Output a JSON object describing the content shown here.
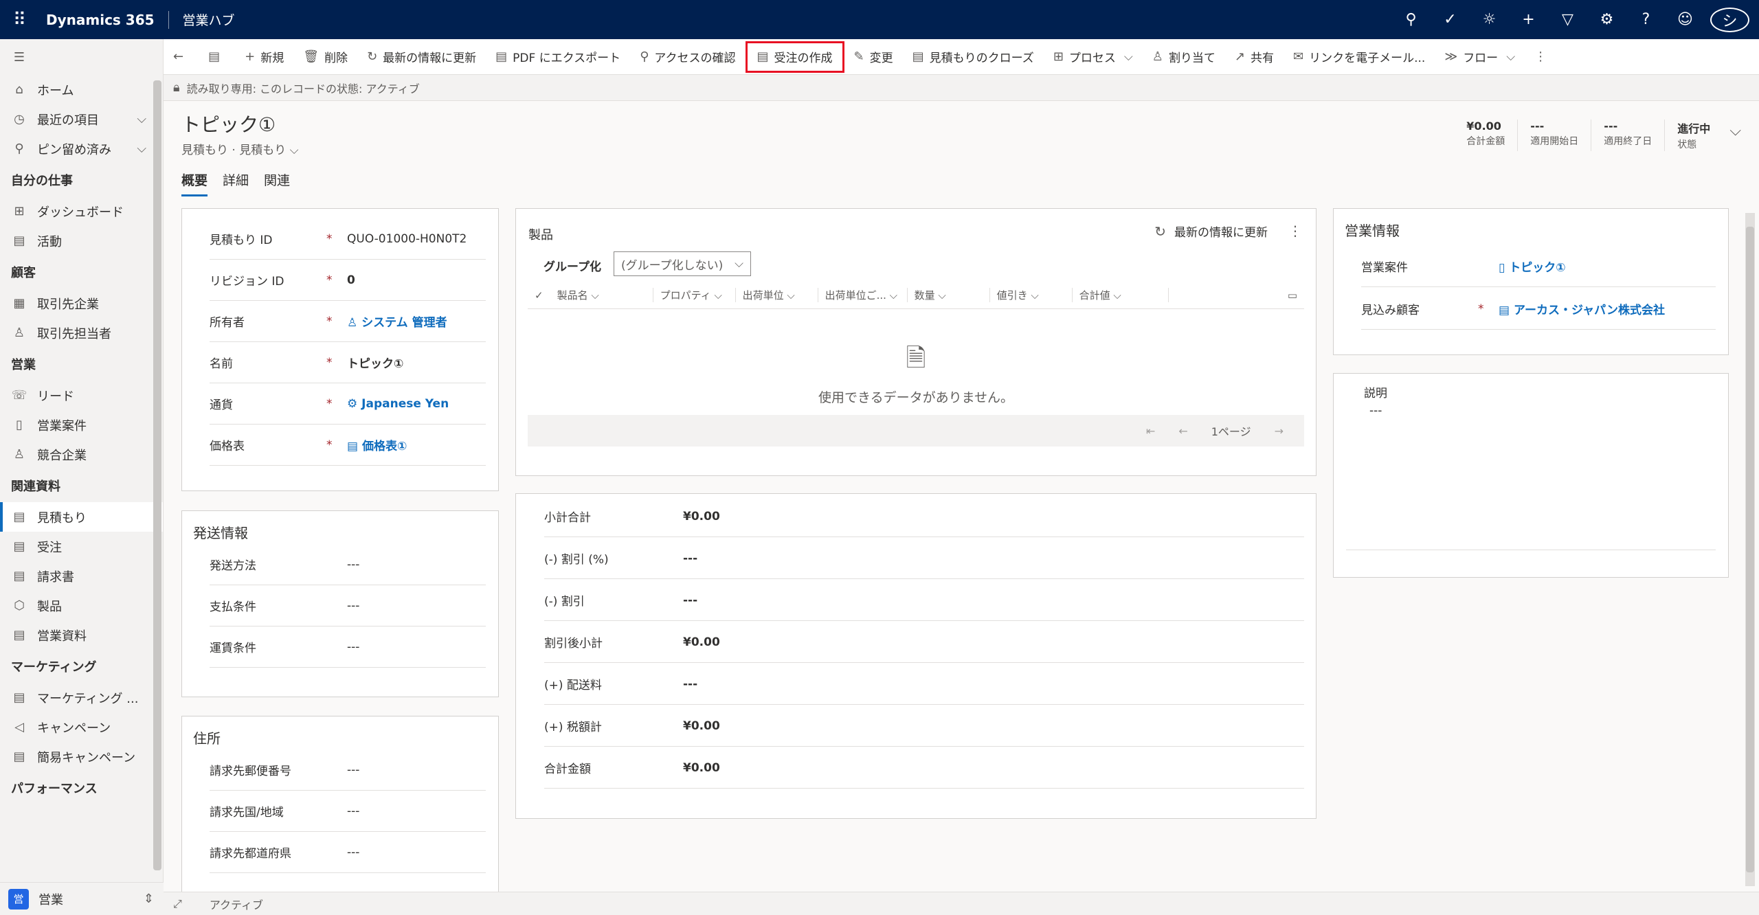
{
  "app": {
    "title": "Dynamics 365",
    "hub": "営業ハブ",
    "avatar": "シ"
  },
  "sidebar": {
    "items": [
      {
        "type": "item",
        "icon": "⌂",
        "label": "ホーム"
      },
      {
        "type": "item",
        "icon": "◷",
        "label": "最近の項目",
        "chev": "⌵"
      },
      {
        "type": "item",
        "icon": "⚲",
        "label": "ピン留め済み",
        "chev": "⌵"
      },
      {
        "type": "group",
        "label": "自分の仕事"
      },
      {
        "type": "item",
        "icon": "⊞",
        "label": "ダッシュボード"
      },
      {
        "type": "item",
        "icon": "▤",
        "label": "活動"
      },
      {
        "type": "group",
        "label": "顧客"
      },
      {
        "type": "item",
        "icon": "▦",
        "label": "取引先企業"
      },
      {
        "type": "item",
        "icon": "♙",
        "label": "取引先担当者"
      },
      {
        "type": "group",
        "label": "営業"
      },
      {
        "type": "item",
        "icon": "☏",
        "label": "リード"
      },
      {
        "type": "item",
        "icon": "▯",
        "label": "営業案件"
      },
      {
        "type": "item",
        "icon": "♙",
        "label": "競合企業"
      },
      {
        "type": "group",
        "label": "関連資料"
      },
      {
        "type": "item",
        "icon": "▤",
        "label": "見積もり",
        "active": true
      },
      {
        "type": "item",
        "icon": "▤",
        "label": "受注"
      },
      {
        "type": "item",
        "icon": "▤",
        "label": "請求書"
      },
      {
        "type": "item",
        "icon": "⬡",
        "label": "製品"
      },
      {
        "type": "item",
        "icon": "▤",
        "label": "営業資料"
      },
      {
        "type": "group",
        "label": "マーケティング"
      },
      {
        "type": "item",
        "icon": "▤",
        "label": "マーケティング ..."
      },
      {
        "type": "item",
        "icon": "◁",
        "label": "キャンペーン"
      },
      {
        "type": "item",
        "icon": "▤",
        "label": "簡易キャンペーン"
      },
      {
        "type": "group",
        "label": "パフォーマンス"
      }
    ],
    "area": {
      "badge": "営",
      "label": "営業"
    }
  },
  "cmdbar": {
    "items": [
      {
        "icon": "←",
        "label": ""
      },
      {
        "icon": "▤",
        "label": ""
      },
      {
        "icon": "+",
        "label": "新規"
      },
      {
        "icon": "🗑",
        "label": "削除"
      },
      {
        "icon": "↻",
        "label": "最新の情報に更新"
      },
      {
        "icon": "▤",
        "label": "PDF にエクスポート"
      },
      {
        "icon": "⚲",
        "label": "アクセスの確認"
      },
      {
        "icon": "▤",
        "label": "受注の作成",
        "highlight": true
      },
      {
        "icon": "✎",
        "label": "変更"
      },
      {
        "icon": "▤",
        "label": "見積もりのクローズ"
      },
      {
        "icon": "⊞",
        "label": "プロセス",
        "chev": "⌵"
      },
      {
        "icon": "♙",
        "label": "割り当て"
      },
      {
        "icon": "↗",
        "label": "共有"
      },
      {
        "icon": "✉",
        "label": "リンクを電子メール..."
      },
      {
        "icon": "≫",
        "label": "フロー",
        "chev": "⌵"
      },
      {
        "icon": "⋮",
        "label": ""
      }
    ]
  },
  "readonly": "読み取り専用: このレコードの状態: アクティブ",
  "record": {
    "title": "トピック①",
    "subtitle": "見積もり · 見積もり ⌵",
    "header_fields": [
      {
        "value": "¥0.00",
        "label": "合計金額"
      },
      {
        "value": "---",
        "label": "適用開始日"
      },
      {
        "value": "---",
        "label": "適用終了日"
      },
      {
        "value": "進行中",
        "label": "状態"
      }
    ]
  },
  "tabs": [
    "概要",
    "詳細",
    "関連"
  ],
  "general": {
    "rows": [
      {
        "label": "見積もり ID",
        "req": "*",
        "value": "QUO-01000-H0N0T2",
        "style": "plain"
      },
      {
        "label": "リビジョン ID",
        "req": "*",
        "value": "0",
        "style": "bold"
      },
      {
        "label": "所有者",
        "req": "*",
        "value": "♙ システム 管理者",
        "style": "link"
      },
      {
        "label": "名前",
        "req": "*",
        "value": "トピック①",
        "style": "bold"
      },
      {
        "label": "通貨",
        "req": "*",
        "value": "⚙ Japanese Yen",
        "style": "link"
      },
      {
        "label": "価格表",
        "req": "*",
        "value": "▤ 価格表①",
        "style": "link"
      }
    ]
  },
  "shipping": {
    "title": "発送情報",
    "rows": [
      {
        "label": "発送方法",
        "value": "---"
      },
      {
        "label": "支払条件",
        "value": "---"
      },
      {
        "label": "運賃条件",
        "value": "---"
      }
    ]
  },
  "address": {
    "title": "住所",
    "rows": [
      {
        "label": "請求先郵便番号",
        "value": "---"
      },
      {
        "label": "請求先国/地域",
        "value": "---"
      },
      {
        "label": "請求先都道府県",
        "value": "---"
      }
    ]
  },
  "products": {
    "title": "製品",
    "refresh": "最新の情報に更新",
    "group_label": "グループ化",
    "group_value": "(グループ化しない)",
    "columns": [
      "製品名",
      "プロパティ",
      "出荷単位",
      "出荷単位ご...",
      "数量",
      "値引き",
      "合計値"
    ],
    "empty": "使用できるデータがありません。",
    "page": "1ページ"
  },
  "totals": {
    "rows": [
      {
        "label": "小計合計",
        "value": "¥0.00"
      },
      {
        "label": "(-) 割引 (%)",
        "value": "---"
      },
      {
        "label": "(-) 割引",
        "value": "---"
      },
      {
        "label": "割引後小計",
        "value": "¥0.00"
      },
      {
        "label": "(+) 配送料",
        "value": "---"
      },
      {
        "label": "(+) 税額計",
        "value": "¥0.00"
      },
      {
        "label": "合計金額",
        "value": "¥0.00"
      }
    ]
  },
  "sales_info": {
    "title": "営業情報",
    "rows": [
      {
        "label": "営業案件",
        "req": "",
        "value": "▯ トピック①"
      },
      {
        "label": "見込み顧客",
        "req": "*",
        "value": "▤ アーカス・ジャパン株式会社"
      }
    ]
  },
  "description": {
    "label": "説明",
    "value": "---"
  },
  "status": "アクティブ"
}
